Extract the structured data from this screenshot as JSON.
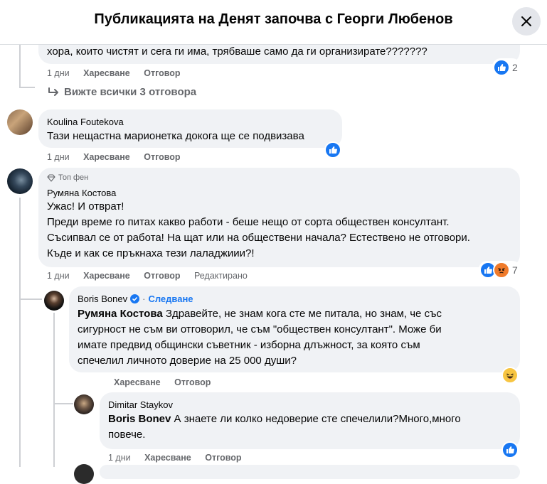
{
  "header": {
    "title": "Публикацията на Денят започва с Георги Любенов"
  },
  "comments": {
    "c0": {
      "text": "хора, които чистят и сега ги има, трябваше само да ги организирате???????",
      "time": "1 дни",
      "like": "Харесване",
      "reply": "Отговор",
      "reactions": "2"
    },
    "view_replies": "Вижте всички 3 отговора",
    "c1": {
      "author": "Koulina Foutekova",
      "text": "Тази нещастна марионетка докога ще се подвизава",
      "time": "1 дни",
      "like": "Харесване",
      "reply": "Отговор"
    },
    "c2": {
      "badge": "Топ фен",
      "author": "Румяна Костова",
      "lines": [
        "Ужас! И отврат!",
        "Преди време го питах какво работи - беше нещо от сорта обществен консултант.",
        "Съсипвал се от работа! На щат или на обществени начала? Естествено не отговори.",
        "Къде и как се пръкнаха тези лаладжиии?!"
      ],
      "time": "1 дни",
      "like": "Харесване",
      "reply": "Отговор",
      "edited": "Редактирано",
      "reactions": "7"
    },
    "c3": {
      "author": "Boris Bonev",
      "follow": "Следване",
      "mention": "Румяна Костова",
      "lines": [
        " Здравейте, не знам кога сте ме питала, но знам, че със",
        "сигурност не съм ви отговорил, че съм \"обществен консултант\". Може би",
        "имате предвид общински съветник - изборна длъжност, за която съм",
        "спечелил личното доверие на 25 000 души?"
      ],
      "like": "Харесване",
      "reply": "Отговор"
    },
    "c4": {
      "author": "Dimitar Staykov",
      "mention": "Boris Bonev",
      "lines": [
        " А знаете ли колко недоверие сте спечелили?Много,много",
        "повече."
      ],
      "time": "1 дни",
      "like": "Харесване",
      "reply": "Отговор"
    }
  },
  "colors": {
    "like": "#1877f2",
    "bubble": "#f0f2f5",
    "meta": "#65676b"
  }
}
